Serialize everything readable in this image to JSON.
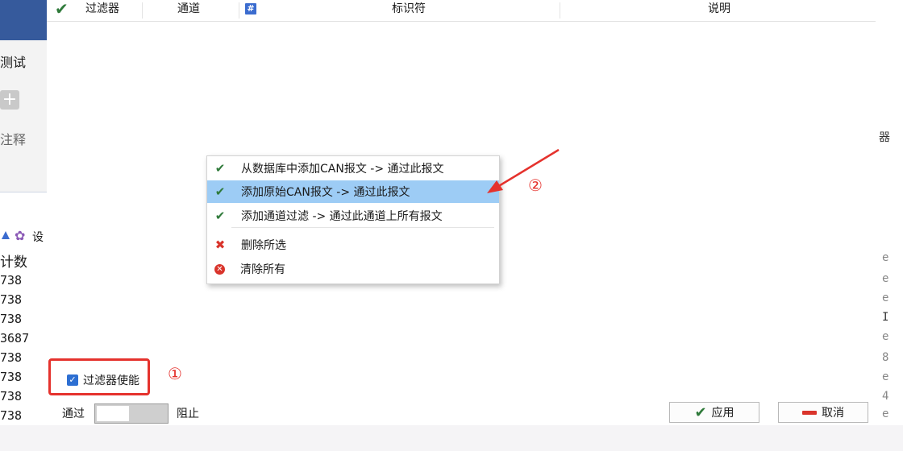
{
  "background_left": {
    "ribbon_text_1": "测试",
    "plus_symbol": "+",
    "ribbon_text_2": "注释",
    "toolbar_text": "设",
    "column_header": "计数",
    "values": [
      "738",
      "738",
      "738",
      "3687",
      "738",
      "738",
      "738",
      "738"
    ]
  },
  "background_right": {
    "partial_chars": [
      "器",
      "e",
      "e",
      "e",
      "I",
      "e",
      "8",
      "e",
      "4",
      "e"
    ]
  },
  "table_header": {
    "filter": "过滤器",
    "channel": "通道",
    "identifier": "标识符",
    "description": "说明"
  },
  "context_menu": {
    "items": [
      {
        "icon": "check-icon",
        "label": "从数据库中添加CAN报文 -> 通过此报文"
      },
      {
        "icon": "check-icon",
        "label": "添加原始CAN报文 -> 通过此报文",
        "selected": true
      },
      {
        "icon": "check-icon",
        "label": "添加通道过滤 -> 通过此通道上所有报文"
      },
      {
        "icon": "x-icon",
        "label": "删除所选"
      },
      {
        "icon": "x-circle-icon",
        "label": "清除所有"
      }
    ]
  },
  "annotations": {
    "circle_1": "①",
    "circle_2": "②",
    "highlight_color": "#e5322d"
  },
  "filter_enable": {
    "label": "过滤器使能",
    "checked": true
  },
  "pass_block_toggle": {
    "pass_label": "通过",
    "block_label": "阻止"
  },
  "buttons": {
    "apply": "应用",
    "cancel": "取消"
  },
  "colors": {
    "accent": "#2d6fd2",
    "menu_selected": "#9dccf5",
    "check_green": "#2f7a3a",
    "red": "#d9342b"
  }
}
